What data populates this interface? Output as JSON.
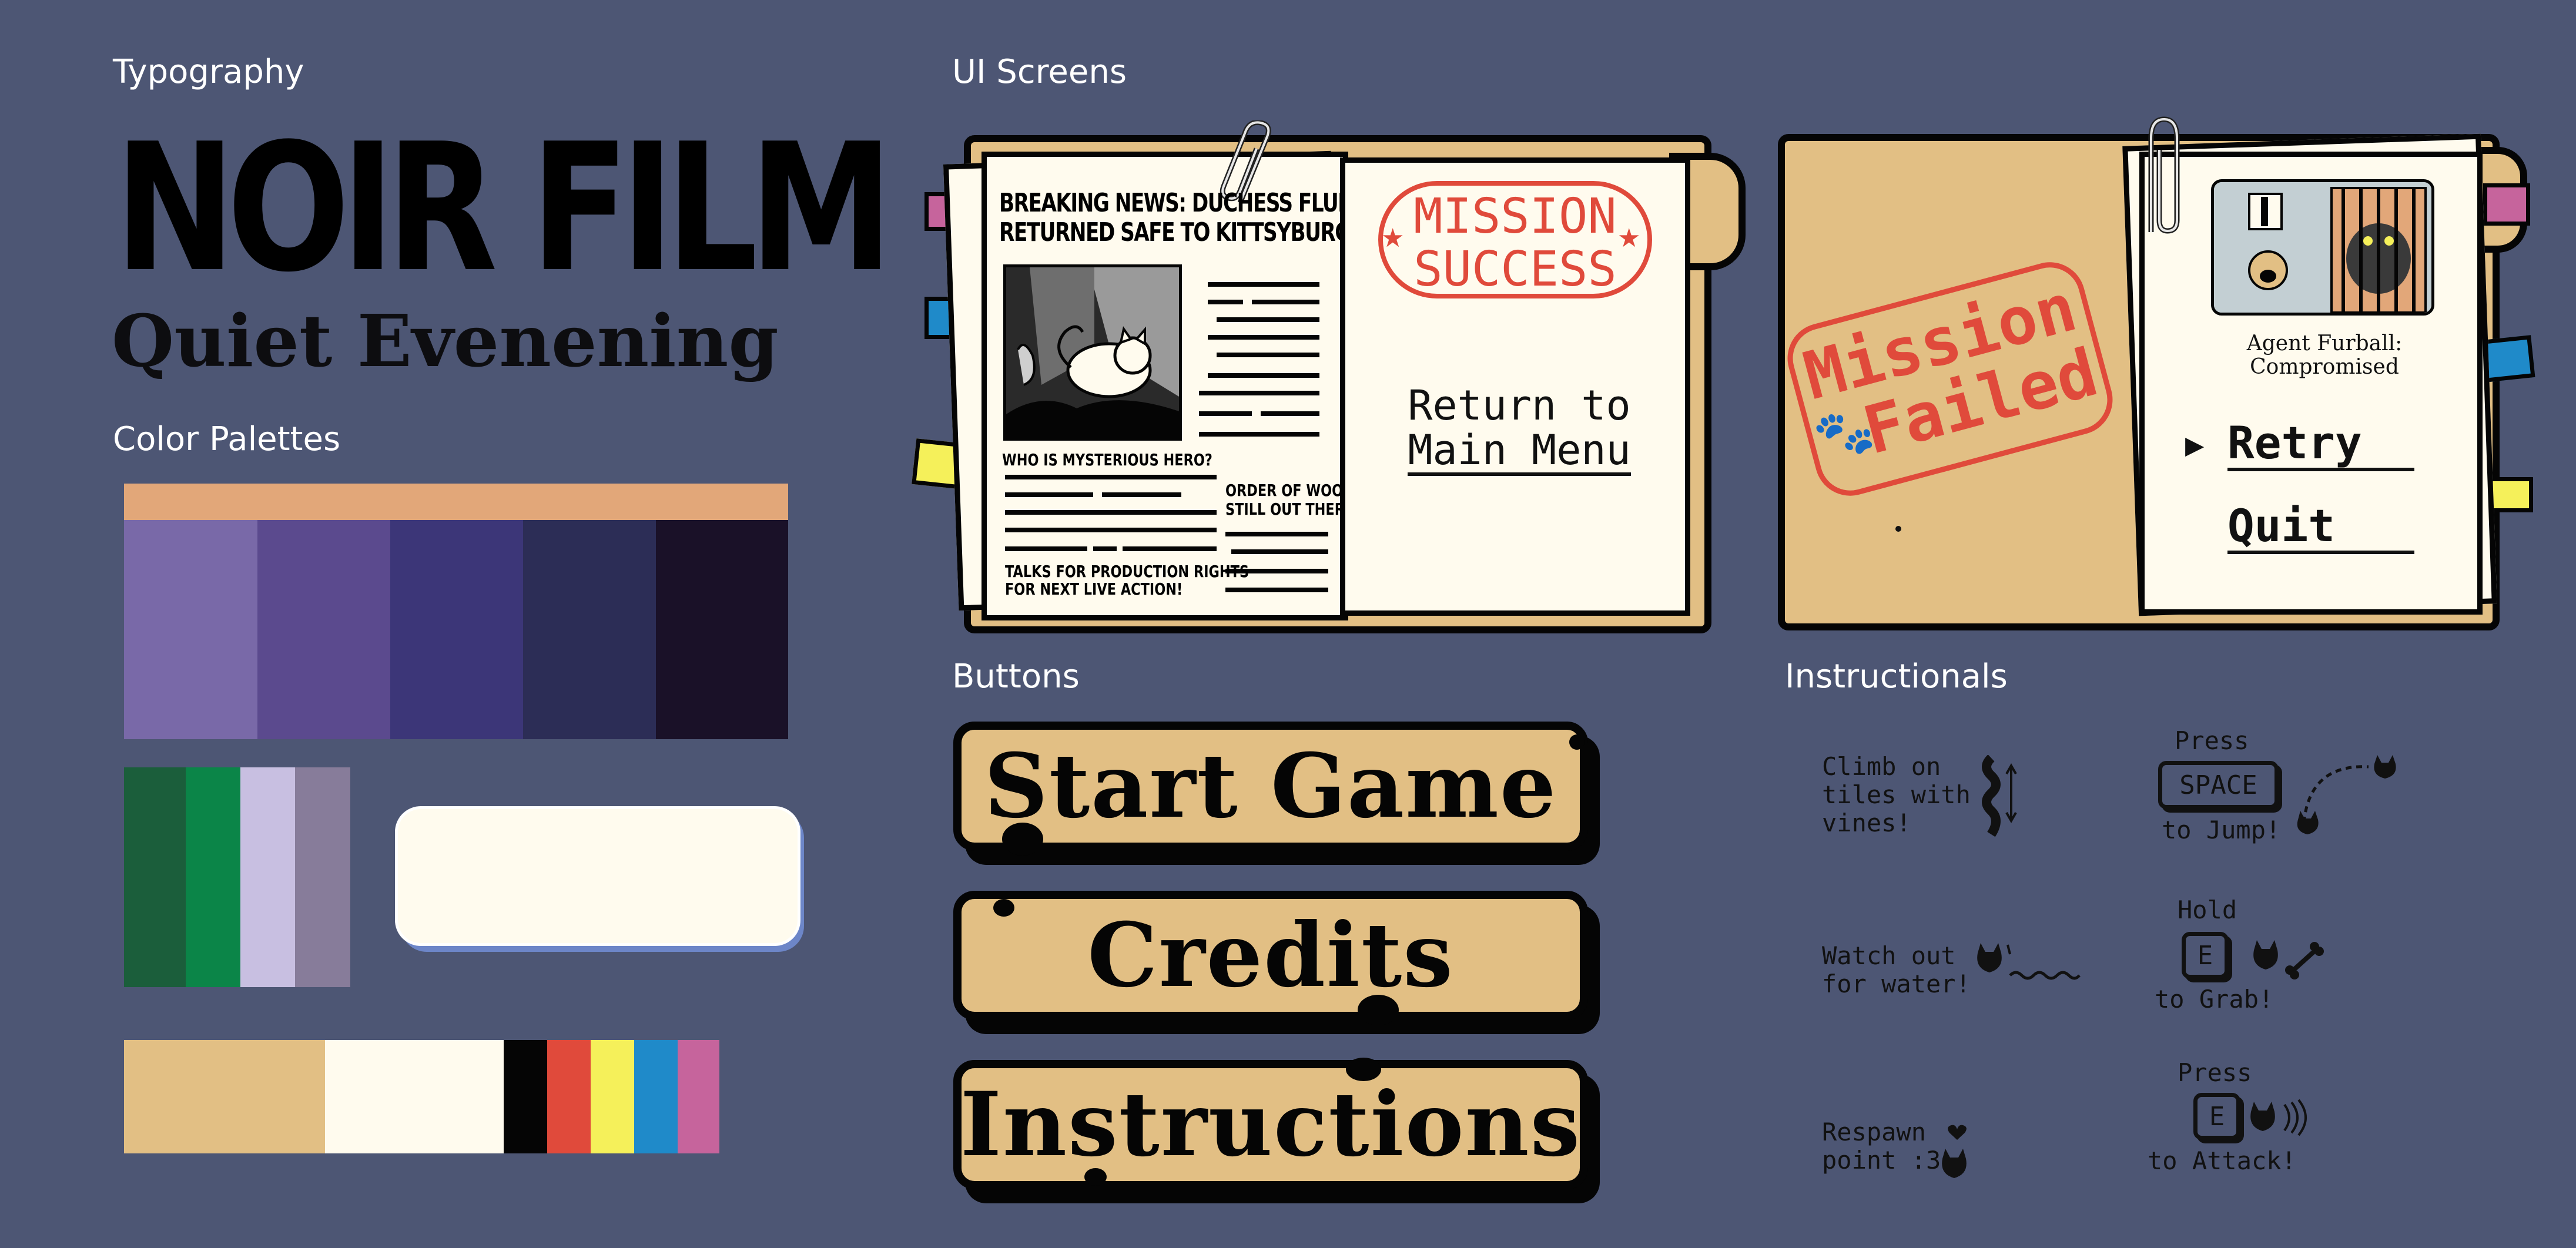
{
  "sections": {
    "typography": "Typography",
    "color_palettes": "Color Palettes",
    "ui_screens": "UI Screens",
    "buttons": "Buttons",
    "instructionals": "Instructionals"
  },
  "typography": {
    "title_font_sample": "NOIR FILM",
    "body_font_sample": "Quiet Evenening"
  },
  "palettes": {
    "purple": [
      "#e2a779",
      "#7969a8",
      "#5b4a8e",
      "#3c3678",
      "#2c2d56",
      "#1a1128"
    ],
    "green": [
      "#1b5e3b",
      "#0b8548",
      "#c8bfe1",
      "#877c9a"
    ],
    "paper_swatch": "#fffbee",
    "accents": [
      "#e2bf84",
      "#fffbee",
      "#050505",
      "#e04a3b",
      "#f5f05a",
      "#1f8ac9",
      "#c6649c"
    ]
  },
  "success_screen": {
    "headline_line1": "BREAKING NEWS: DUCHESS FLUFFY",
    "headline_line2": "RETURNED SAFE TO KITTSYBURGH!",
    "sub1": "WHO IS MYSTERIOUS HERO?",
    "sub2_line1": "ORDER OF WOOF",
    "sub2_line2": "STILL OUT THERE?",
    "sub3_line1": "TALKS FOR PRODUCTION RIGHTS",
    "sub3_line2": "FOR NEXT LIVE ACTION!",
    "stamp_line1": "MISSION",
    "stamp_line2": "SUCCESS",
    "return_line1": "Return to",
    "return_line2": "Main Menu"
  },
  "failed_screen": {
    "stamp_line1": "Mission",
    "stamp_line2": "Failed",
    "agent_line1": "Agent Furball:",
    "agent_line2": "Compromised",
    "retry": "Retry",
    "quit": "Quit"
  },
  "buttons": {
    "start": "Start Game",
    "credits": "Credits",
    "instructions": "Instructions"
  },
  "instructionals": {
    "climb": [
      "Climb on",
      "tiles with",
      "vines!"
    ],
    "jump_press": "Press",
    "jump_key": "SPACE",
    "jump_to": "to Jump!",
    "water": [
      "Watch out",
      "for water!"
    ],
    "grab_hold": "Hold",
    "grab_key": "E",
    "grab_to": "to Grab!",
    "respawn": [
      "Respawn",
      "point :3"
    ],
    "attack_press": "Press",
    "attack_key": "E",
    "attack_to": "to Attack!"
  }
}
